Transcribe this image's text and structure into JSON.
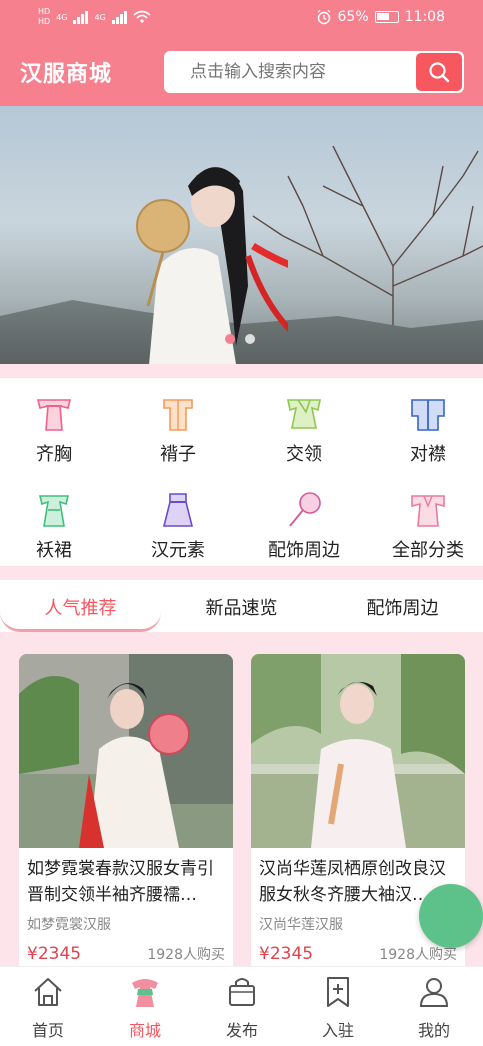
{
  "status_bar": {
    "hd1": "HD",
    "hd2": "HD",
    "net1": "4G",
    "net2": "4G",
    "battery": "65%",
    "time": "11:08"
  },
  "header": {
    "title": "汉服商城",
    "search_placeholder": "点击输入搜索内容"
  },
  "banner": {
    "dots": 2,
    "active_dot": 0
  },
  "categories": [
    {
      "label": "齐胸",
      "icon": "qixiong-garment-icon",
      "color": "#f0608a"
    },
    {
      "label": "褙子",
      "icon": "beizi-garment-icon",
      "color": "#f49a5a"
    },
    {
      "label": "交领",
      "icon": "jiaoling-garment-icon",
      "color": "#8cc84b"
    },
    {
      "label": "对襟",
      "icon": "duijin-garment-icon",
      "color": "#3a64c8"
    },
    {
      "label": "袄裙",
      "icon": "aoqun-garment-icon",
      "color": "#3fbf7a"
    },
    {
      "label": "汉元素",
      "icon": "hanyuansu-garment-icon",
      "color": "#6a4bc8"
    },
    {
      "label": "配饰周边",
      "icon": "fan-accessory-icon",
      "color": "#d65a9a"
    },
    {
      "label": "全部分类",
      "icon": "all-category-garment-icon",
      "color": "#e87a9a"
    }
  ],
  "tabs": [
    {
      "label": "人气推荐",
      "active": true
    },
    {
      "label": "新品速览",
      "active": false
    },
    {
      "label": "配饰周边",
      "active": false
    }
  ],
  "products": [
    {
      "title": "如梦霓裳春款汉服女青引晋制交领半袖齐腰襦…",
      "shop": "如梦霓裳汉服",
      "price": "¥2345",
      "sales": "1928人购买"
    },
    {
      "title": "汉尚华莲凤栖原创改良汉服女秋冬齐腰大袖汉…",
      "shop": "汉尚华莲汉服",
      "price": "¥2345",
      "sales": "1928人购买"
    }
  ],
  "bottom_nav": [
    {
      "label": "首页",
      "icon": "home-icon",
      "active": false
    },
    {
      "label": "商城",
      "icon": "mall-hanfu-icon",
      "active": true
    },
    {
      "label": "发布",
      "icon": "bag-icon",
      "active": false
    },
    {
      "label": "入驻",
      "icon": "bookmark-plus-icon",
      "active": false
    },
    {
      "label": "我的",
      "icon": "user-icon",
      "active": false
    }
  ],
  "colors": {
    "brand": "#f7808f",
    "accent": "#f7575f",
    "price": "#e0424e",
    "fab": "#5dc18a"
  }
}
